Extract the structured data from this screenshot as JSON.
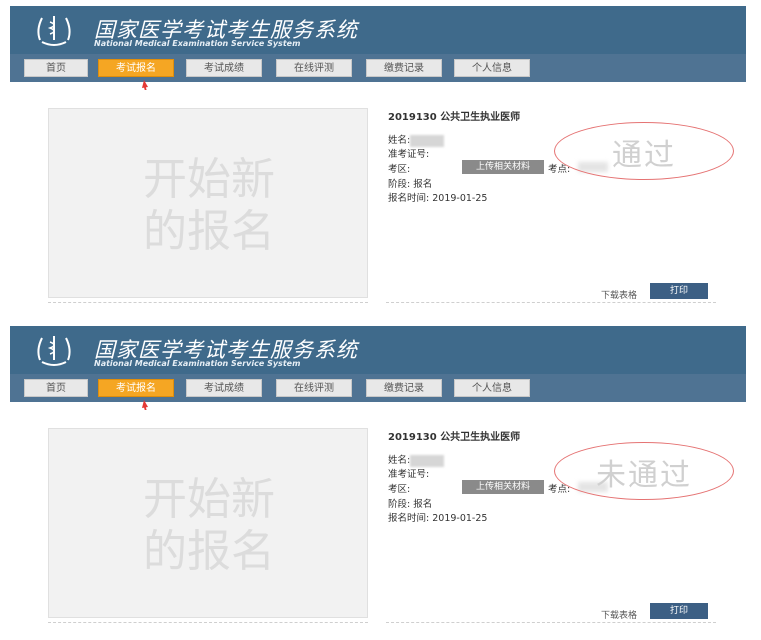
{
  "header": {
    "title": "国家医学考试考生服务系统",
    "subtitle": "National Medical Examination Service System",
    "logo_icon": "medical-emblem-icon"
  },
  "nav": {
    "tabs": [
      "首页",
      "考试报名",
      "考试成绩",
      "在线评测",
      "缴费记录",
      "个人信息"
    ],
    "active": "考试报名"
  },
  "placeholder": {
    "line1": "开始新",
    "line2": "的报名"
  },
  "exam": {
    "title": "2019130 公共卫生执业医师",
    "name_label": "姓名:",
    "ticket_label": "准考证号:",
    "area_label": "考区:",
    "upload_button": "上传相关材料",
    "site_label": "考点:",
    "stage_label": "阶段:",
    "stage_value": "报名",
    "time_label": "报名时间:",
    "time_value": "2019-01-25"
  },
  "panels": [
    {
      "status": "通过"
    },
    {
      "status": "未通过"
    }
  ],
  "actions": {
    "download": "下载表格",
    "print": "打印"
  },
  "colors": {
    "header_bg": "#3f6a8b",
    "nav_bg": "#4f7393",
    "active_tab": "#f5a623",
    "stamp_circle": "#e57373",
    "arrow": "#e53935",
    "print_button": "#3c5f84"
  }
}
